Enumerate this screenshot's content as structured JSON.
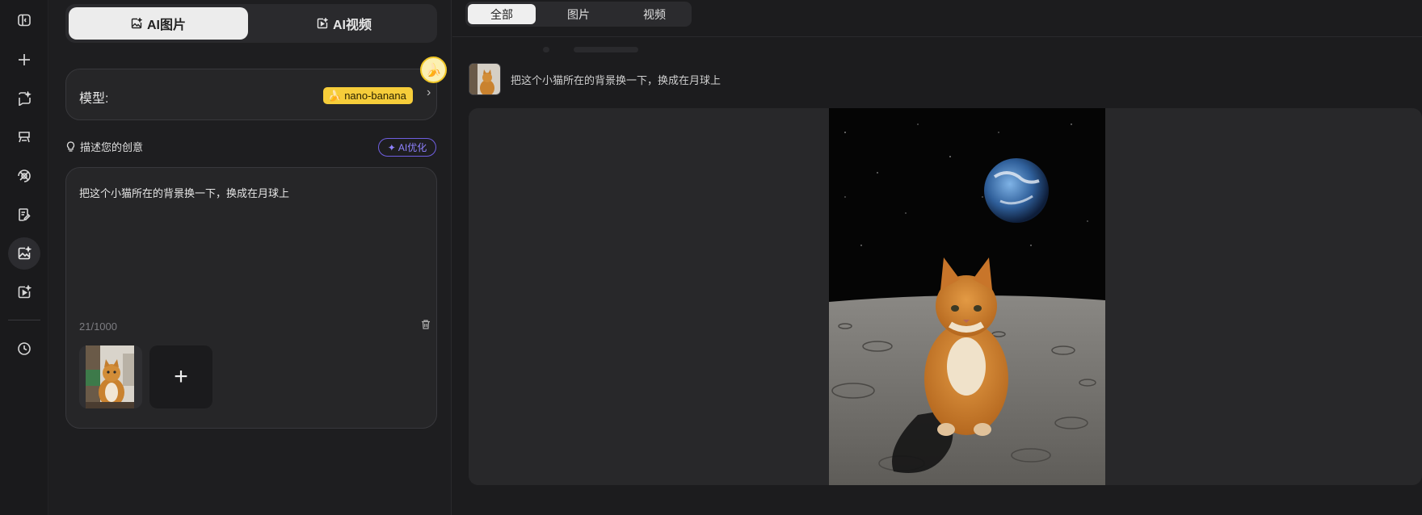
{
  "rail": {
    "items": [
      {
        "name": "collapse-sidebar-icon"
      },
      {
        "name": "new-chat-icon"
      },
      {
        "name": "ai-chat-icon"
      },
      {
        "name": "ai-writing-icon"
      },
      {
        "name": "ai-agent-icon"
      },
      {
        "name": "ai-edit-icon"
      },
      {
        "name": "ai-image-icon",
        "active": true
      },
      {
        "name": "ai-video-icon"
      },
      {
        "name": "history-icon"
      }
    ]
  },
  "panel": {
    "mode_image_label": "AI图片",
    "mode_video_label": "AI视频",
    "model_label": "模型:",
    "model_name": "nano-banana",
    "describe_label": "描述您的创意",
    "ai_optimize_label": "AI优化",
    "prompt_text": "把这个小猫所在的背景换一下，换成在月球上",
    "char_count": "21/1000",
    "add_symbol": "+"
  },
  "main": {
    "tabs": [
      "全部",
      "图片",
      "视频"
    ],
    "active_tab": "全部",
    "history_prompt": "把这个小猫所在的背景换一下，换成在月球上"
  },
  "colors": {
    "accent_yellow": "#f6cd3a",
    "accent_purple": "#8f82ff",
    "background": "#1c1c1e"
  }
}
